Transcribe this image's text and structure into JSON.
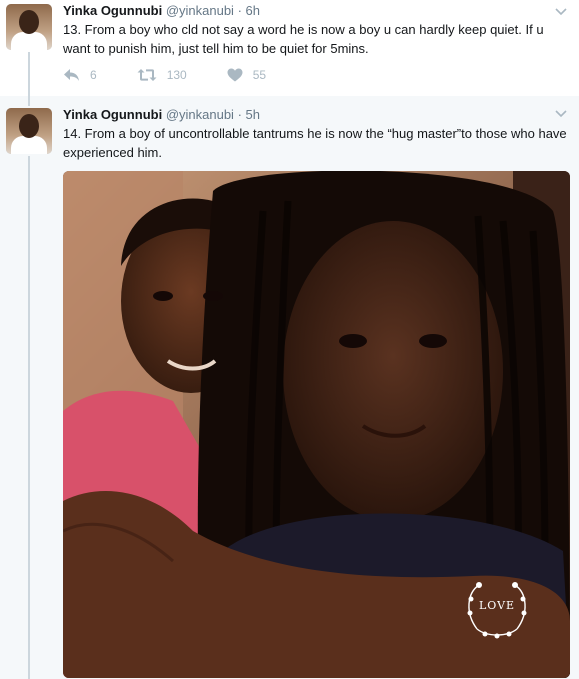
{
  "tweets": [
    {
      "author_name": "Yinka Ogunnubi",
      "handle": "@yinkanubi",
      "separator": "·",
      "time": "6h",
      "text": "13. From a boy who cld not say a word he is now a boy u can hardly keep quiet. If u want to punish him, just tell him to be quiet for 5mins.",
      "reply_count": "6",
      "retweet_count": "130",
      "like_count": "55"
    },
    {
      "author_name": "Yinka Ogunnubi",
      "handle": "@yinkanubi",
      "separator": "·",
      "time": "5h",
      "text": "14. From a boy of uncontrollable tantrums he is now the “hug master”to those who have experienced him.",
      "photo_sticker_text": "LOVE"
    }
  ],
  "icons": {
    "reply": "reply-icon",
    "retweet": "retweet-icon",
    "like": "heart-icon",
    "caret": "chevron-down-icon"
  },
  "colors": {
    "thread_line": "#ccd6dd",
    "muted_text": "#657786",
    "action_icon": "#aab8c2",
    "highlight_bg": "#f5f8fa"
  }
}
